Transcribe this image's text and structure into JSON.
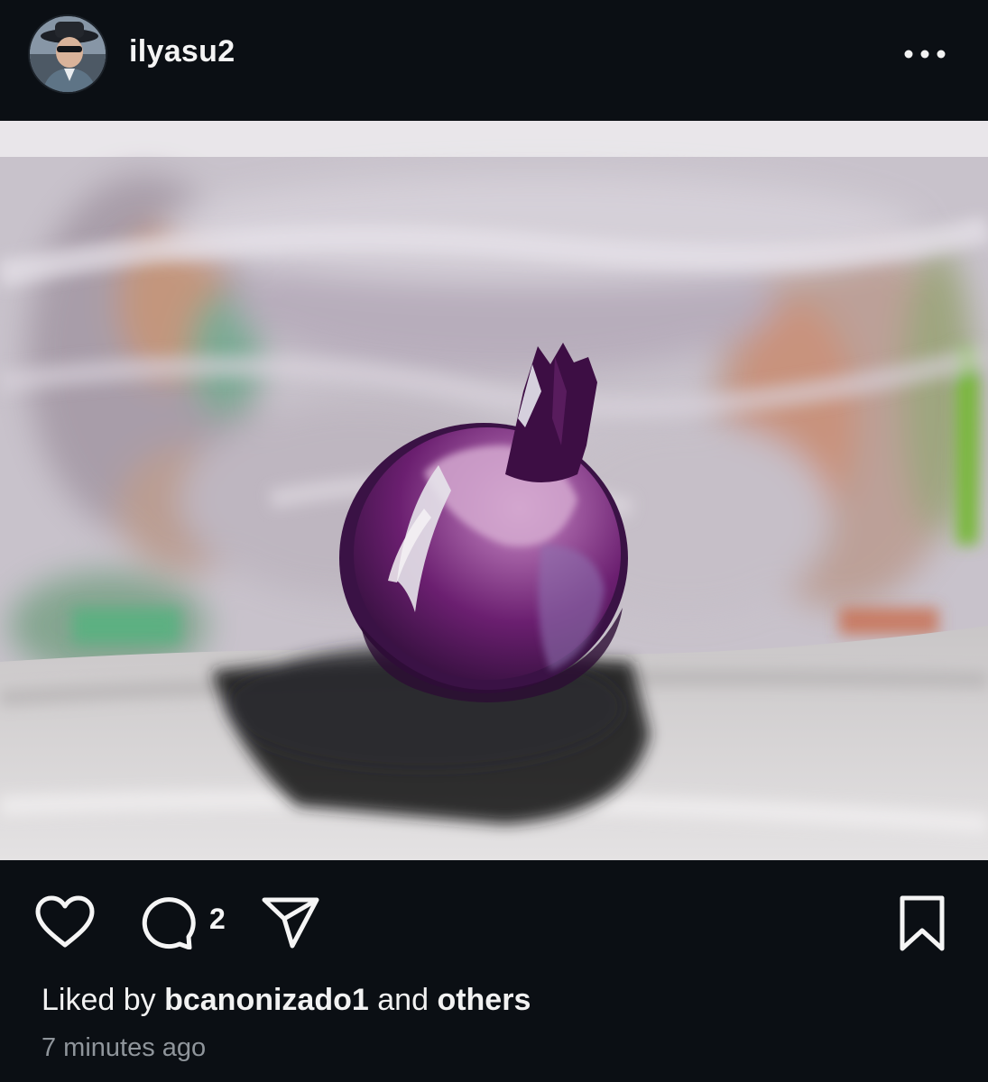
{
  "post": {
    "username": "ilyasu2",
    "more_icon": "more-horizontal-icon",
    "image_alt": "Digital painting of a purple onion on a table"
  },
  "actions": {
    "like_icon": "heart-icon",
    "comment_icon": "comment-icon",
    "comment_count": "2",
    "share_icon": "send-icon",
    "save_icon": "bookmark-icon"
  },
  "likes": {
    "prefix": "Liked by",
    "user": "bcanonizado1",
    "connector": "and",
    "others": "others"
  },
  "timestamp": "7 minutes ago",
  "colors": {
    "background": "#0b0f14",
    "text": "#f5f5f5",
    "muted": "#8f959b",
    "onion": "#6a1f6e"
  }
}
